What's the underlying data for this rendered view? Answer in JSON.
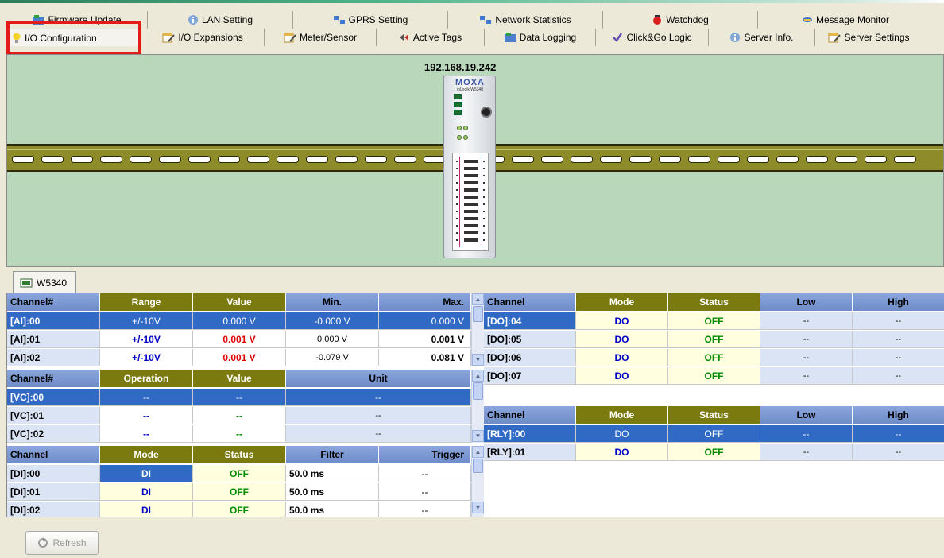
{
  "colors": {
    "accent_red": "#e31b1b",
    "selected_row": "#316ac5",
    "header_blue": "#7592d0",
    "header_olive": "#7b7a0e",
    "canvas_bg": "#b9d8bb",
    "rail": "#8e8b2a"
  },
  "tabs_row1": [
    {
      "label": "Firmware Update",
      "icon": "firmware-icon"
    },
    {
      "label": "LAN Setting",
      "icon": "info-icon"
    },
    {
      "label": "GPRS Setting",
      "icon": "network-icon"
    },
    {
      "label": "Network Statistics",
      "icon": "network-icon"
    },
    {
      "label": "Watchdog",
      "icon": "watchdog-icon"
    },
    {
      "label": "Message Monitor",
      "icon": "message-icon"
    }
  ],
  "tabs_row2": [
    {
      "label": "I/O Configuration",
      "icon": "bulb-icon"
    },
    {
      "label": "I/O Expansions",
      "icon": "edit-icon"
    },
    {
      "label": "Meter/Sensor",
      "icon": "edit-icon"
    },
    {
      "label": "Active Tags",
      "icon": "tags-icon"
    },
    {
      "label": "Data Logging",
      "icon": "firmware-icon"
    },
    {
      "label": "Click&Go Logic",
      "icon": "logic-icon"
    },
    {
      "label": "Server Info.",
      "icon": "info-icon"
    },
    {
      "label": "Server Settings",
      "icon": "edit-icon"
    }
  ],
  "device": {
    "ip": "192.168.19.242",
    "brand": "MOXA",
    "model": "ioLogik W5340"
  },
  "device_tab": {
    "label": "W5340"
  },
  "ai_table": {
    "headers": [
      "Channel#",
      "Range",
      "Value",
      "Min.",
      "Max."
    ],
    "rows": [
      [
        "[AI]:00",
        "+/-10V",
        "0.000 V",
        "-0.000 V",
        "0.000 V"
      ],
      [
        "[AI]:01",
        "+/-10V",
        "0.001 V",
        "0.000 V",
        "0.001 V"
      ],
      [
        "[AI]:02",
        "+/-10V",
        "0.001 V",
        "-0.079 V",
        "0.081 V"
      ]
    ]
  },
  "vc_table": {
    "headers": [
      "Channel#",
      "Operation",
      "Value",
      "Unit"
    ],
    "rows": [
      [
        "[VC]:00",
        "--",
        "--",
        "--"
      ],
      [
        "[VC]:01",
        "--",
        "--",
        "--"
      ],
      [
        "[VC]:02",
        "--",
        "--",
        "--"
      ]
    ]
  },
  "di_table": {
    "headers": [
      "Channel",
      "Mode",
      "Status",
      "Filter",
      "Trigger"
    ],
    "rows": [
      [
        "[DI]:00",
        "DI",
        "OFF",
        "50.0 ms",
        "--"
      ],
      [
        "[DI]:01",
        "DI",
        "OFF",
        "50.0 ms",
        "--"
      ],
      [
        "[DI]:02",
        "DI",
        "OFF",
        "50.0 ms",
        "--"
      ]
    ]
  },
  "do_table": {
    "headers": [
      "Channel",
      "Mode",
      "Status",
      "Low",
      "High"
    ],
    "rows": [
      [
        "[DO]:04",
        "DO",
        "OFF",
        "--",
        "--"
      ],
      [
        "[DO]:05",
        "DO",
        "OFF",
        "--",
        "--"
      ],
      [
        "[DO]:06",
        "DO",
        "OFF",
        "--",
        "--"
      ],
      [
        "[DO]:07",
        "DO",
        "OFF",
        "--",
        "--"
      ]
    ]
  },
  "rly_table": {
    "headers": [
      "Channel",
      "Mode",
      "Status",
      "Low",
      "High"
    ],
    "rows": [
      [
        "[RLY]:00",
        "DO",
        "OFF",
        "--",
        "--"
      ],
      [
        "[RLY]:01",
        "DO",
        "OFF",
        "--",
        "--"
      ]
    ]
  },
  "refresh": {
    "label": "Refresh"
  }
}
